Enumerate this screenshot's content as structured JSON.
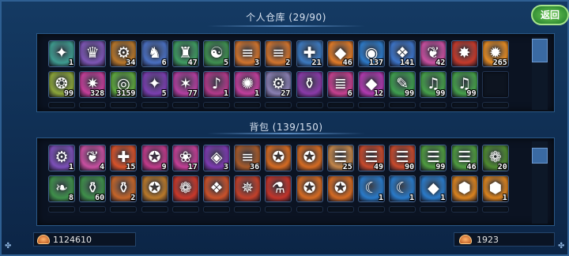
{
  "warehouse": {
    "title": "个人仓库 (29/90)",
    "items": [
      {
        "icon": "green-gem-cluster-icon",
        "glyph": "✦",
        "bg": "#3e9b8f",
        "count": "1"
      },
      {
        "icon": "winged-crest-icon",
        "glyph": "♛",
        "bg": "#7d55b5",
        "count": ""
      },
      {
        "icon": "golden-mech-icon",
        "glyph": "⚙",
        "bg": "#b7762a",
        "count": "34"
      },
      {
        "icon": "puzzle-robot-icon",
        "glyph": "♞",
        "bg": "#4a6fc0",
        "count": "6"
      },
      {
        "icon": "puzzle-mage-icon",
        "glyph": "♜",
        "bg": "#3f9a60",
        "count": "47"
      },
      {
        "icon": "puzzle-panda-icon",
        "glyph": "☯",
        "bg": "#3f8f50",
        "count": "5"
      },
      {
        "icon": "orange-scroll-icon",
        "glyph": "≡",
        "bg": "#d0742e",
        "count": "3"
      },
      {
        "icon": "orange-scroll-icon",
        "glyph": "≡",
        "bg": "#d0742e",
        "count": "2"
      },
      {
        "icon": "puzzle-scroll-icon",
        "glyph": "✚",
        "bg": "#3c79bf",
        "count": "21"
      },
      {
        "icon": "orange-crystal-icon",
        "glyph": "◆",
        "bg": "#e07b28",
        "count": "46"
      },
      {
        "icon": "blue-orb-icon",
        "glyph": "◉",
        "bg": "#2d7ac8",
        "count": "137"
      },
      {
        "icon": "blue-crystal-icon",
        "glyph": "❖",
        "bg": "#3c74c8",
        "count": "141"
      },
      {
        "icon": "pink-feather-icon",
        "glyph": "❦",
        "bg": "#c84fa0",
        "count": "42"
      },
      {
        "icon": "red-gold-flag-icon",
        "glyph": "✸",
        "bg": "#c43a2b",
        "count": ""
      },
      {
        "icon": "orange-flame-icon",
        "glyph": "✹",
        "bg": "#e28a24",
        "count": "265"
      },
      {
        "icon": "green-gold-orb-icon",
        "glyph": "❂",
        "bg": "#8ba53a",
        "count": "99"
      },
      {
        "icon": "pink-spark-icon",
        "glyph": "✷",
        "bg": "#c53f9a",
        "count": "328"
      },
      {
        "icon": "green-orb-icon",
        "glyph": "◎",
        "bg": "#5ea83e",
        "count": "3159"
      },
      {
        "icon": "purple-crystal-icon",
        "glyph": "✦",
        "bg": "#7a3fb0",
        "count": "5"
      },
      {
        "icon": "pink-crystal-cluster-icon",
        "glyph": "✶",
        "bg": "#b33fa0",
        "count": "77"
      },
      {
        "icon": "pink-trumpet-icon",
        "glyph": "♪",
        "bg": "#b13a8a",
        "count": "1"
      },
      {
        "icon": "pink-burst-icon",
        "glyph": "✺",
        "bg": "#c03f9c",
        "count": "1"
      },
      {
        "icon": "silver-mech-icon",
        "glyph": "⚙",
        "bg": "#8a7fb2",
        "count": "27"
      },
      {
        "icon": "purple-vase-icon",
        "glyph": "⚱",
        "bg": "#8a3aa8",
        "count": ""
      },
      {
        "icon": "pink-scroll-icon",
        "glyph": "≣",
        "bg": "#c6408f",
        "count": "6"
      },
      {
        "icon": "pink-diamond-icon",
        "glyph": "◆",
        "bg": "#b03ab0",
        "count": "12"
      },
      {
        "icon": "green-scroll-icon",
        "glyph": "✎",
        "bg": "#3f9f4f",
        "count": "99"
      },
      {
        "icon": "green-trumpet-icon",
        "glyph": "♫",
        "bg": "#46a04a",
        "count": "99"
      },
      {
        "icon": "green-trumpet-icon",
        "glyph": "♫",
        "bg": "#46a04a",
        "count": "99"
      }
    ]
  },
  "backpack": {
    "title": "背包 (139/150)",
    "items": [
      {
        "icon": "purple-mech-icon",
        "glyph": "⚙",
        "bg": "#7c4fb8",
        "count": "1"
      },
      {
        "icon": "pink-feather-icon",
        "glyph": "❦",
        "bg": "#c84fa0",
        "count": "4"
      },
      {
        "icon": "gift-box-icon",
        "glyph": "✚",
        "bg": "#d6522a",
        "count": "15"
      },
      {
        "icon": "money-bag-icon",
        "glyph": "✪",
        "bg": "#c13a8a",
        "count": "9"
      },
      {
        "icon": "pink-flower-icon",
        "glyph": "❀",
        "bg": "#c43f96",
        "count": "17"
      },
      {
        "icon": "purple-gem-icon",
        "glyph": "◈",
        "bg": "#7d3ab0",
        "count": "3"
      },
      {
        "icon": "brown-scroll-icon",
        "glyph": "≡",
        "bg": "#a65a2a",
        "count": "36"
      },
      {
        "icon": "orange-bag-icon",
        "glyph": "✪",
        "bg": "#d36a22",
        "count": ""
      },
      {
        "icon": "orange-bag-icon",
        "glyph": "✪",
        "bg": "#d36a22",
        "count": ""
      },
      {
        "icon": "paper-scroll-icon",
        "glyph": "☰",
        "bg": "#c4874a",
        "count": "25"
      },
      {
        "icon": "red-scroll-icon",
        "glyph": "☰",
        "bg": "#c94a2c",
        "count": "49"
      },
      {
        "icon": "red-scroll-icon",
        "glyph": "☰",
        "bg": "#c94a2c",
        "count": "90"
      },
      {
        "icon": "green-paper-scroll-icon",
        "glyph": "☰",
        "bg": "#4f9c3f",
        "count": "99"
      },
      {
        "icon": "green-paper-scroll-icon",
        "glyph": "☰",
        "bg": "#4f9c3f",
        "count": "46"
      },
      {
        "icon": "purple-grape-icon",
        "glyph": "❁",
        "bg": "#4e8a30",
        "count": "20"
      },
      {
        "icon": "green-leaf-icon",
        "glyph": "❧",
        "bg": "#3f8f4a",
        "count": "8"
      },
      {
        "icon": "green-pot-icon",
        "glyph": "⚱",
        "bg": "#3f8f4a",
        "count": "60"
      },
      {
        "icon": "orange-vase-icon",
        "glyph": "⚱",
        "bg": "#c4652a",
        "count": "2"
      },
      {
        "icon": "gold-bag-icon",
        "glyph": "✪",
        "bg": "#b8782a",
        "count": ""
      },
      {
        "icon": "red-rose-icon",
        "glyph": "❁",
        "bg": "#c8382a",
        "count": ""
      },
      {
        "icon": "orange-wing-icon",
        "glyph": "❖",
        "bg": "#c9512a",
        "count": ""
      },
      {
        "icon": "red-phoenix-icon",
        "glyph": "✵",
        "bg": "#c2402a",
        "count": ""
      },
      {
        "icon": "red-potion-icon",
        "glyph": "⚗",
        "bg": "#c2342a",
        "count": ""
      },
      {
        "icon": "orange-money-bag-icon",
        "glyph": "✪",
        "bg": "#d46a22",
        "count": ""
      },
      {
        "icon": "orange-money-bag-icon",
        "glyph": "✪",
        "bg": "#d46a22",
        "count": ""
      },
      {
        "icon": "crescent-moon-icon",
        "glyph": "☾",
        "bg": "#2a7ac8",
        "count": "1"
      },
      {
        "icon": "crescent-moon-icon",
        "glyph": "☾",
        "bg": "#2a7ac8",
        "count": "1"
      },
      {
        "icon": "blue-diamond-icon",
        "glyph": "◆",
        "bg": "#2a7ac8",
        "count": "1"
      },
      {
        "icon": "orange-hexagon-icon",
        "glyph": "⬢",
        "bg": "#d9821f",
        "count": ""
      },
      {
        "icon": "orange-hexagon-icon",
        "glyph": "⬢",
        "bg": "#d9821f",
        "count": "1"
      }
    ]
  },
  "currency": {
    "left_value": "1124610",
    "right_value": "1923"
  },
  "close_button": {
    "label": "返回"
  },
  "colors": {
    "frame": "#143a63",
    "panel": "#0b1322",
    "accent_blue": "#3a6aa3",
    "close_green": "#4caf50"
  }
}
